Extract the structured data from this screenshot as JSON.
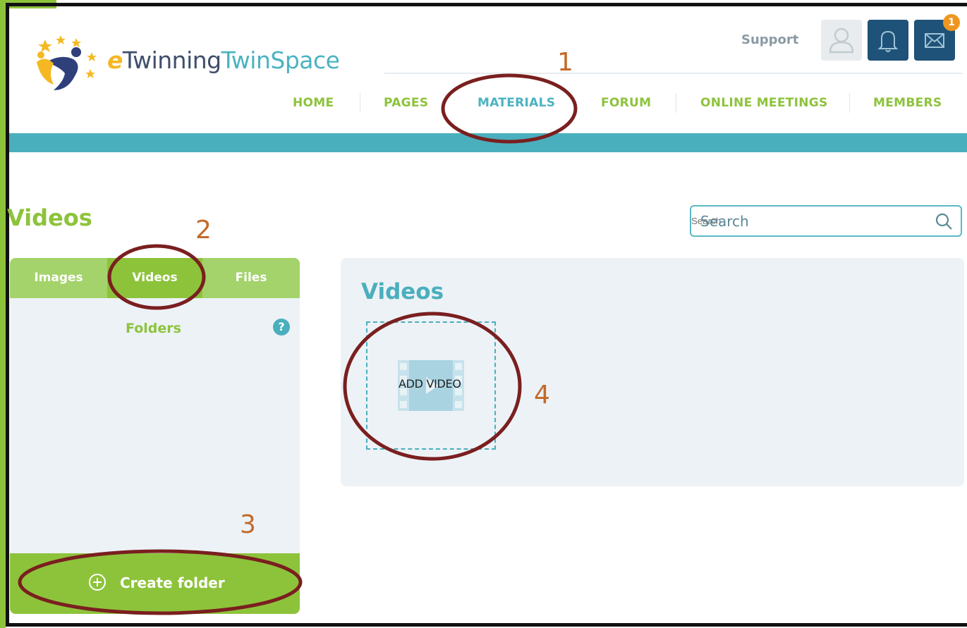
{
  "brand": {
    "logo_e": "e",
    "logo_twinning": "Twinning",
    "logo_twinspace": "TwinSpace"
  },
  "header": {
    "support_label": "Support",
    "message_badge": "1",
    "nav": [
      {
        "label": "HOME"
      },
      {
        "label": "PAGES"
      },
      {
        "label": "MATERIALS",
        "active": true
      },
      {
        "label": "FORUM"
      },
      {
        "label": "ONLINE MEETINGS"
      },
      {
        "label": "MEMBERS"
      }
    ]
  },
  "page": {
    "title": "Videos",
    "search_placeholder": "Search"
  },
  "left_panel": {
    "tabs": [
      {
        "label": "Images"
      },
      {
        "label": "Videos",
        "active": true
      },
      {
        "label": "Files"
      }
    ],
    "folders_label": "Folders",
    "help_label": "?",
    "create_folder_label": "Create folder"
  },
  "right_panel": {
    "title": "Videos",
    "add_video_label": "ADD VIDEO"
  },
  "annotations": {
    "step1": "1",
    "step2": "2",
    "step3": "3",
    "step4": "4"
  },
  "colors": {
    "brand_green": "#8dc33b",
    "brand_teal": "#4aafbd",
    "dark_blue": "#1e5278",
    "annotation_ring": "#7a1f1f",
    "annotation_number": "#c26a2a"
  },
  "icons": [
    "logo-icon",
    "user-icon",
    "bell-icon",
    "mail-icon",
    "search-icon",
    "help-icon",
    "plus-circle-icon",
    "film-icon"
  ]
}
